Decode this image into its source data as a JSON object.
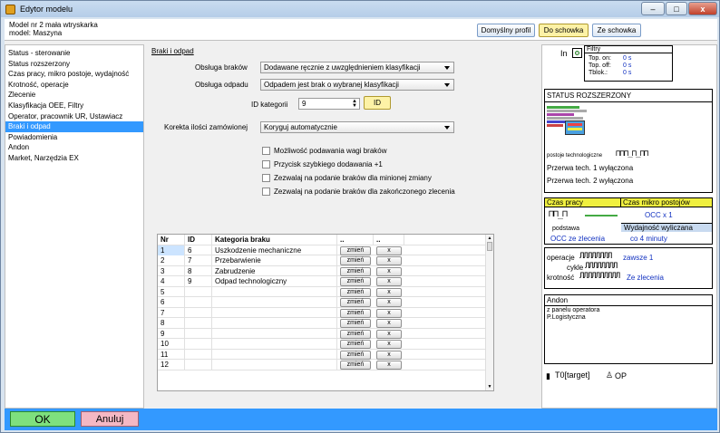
{
  "window": {
    "title": "Edytor modelu",
    "minimize": "–",
    "maximize": "□",
    "close": "x"
  },
  "header": {
    "line1": "Model nr 2  mała wtryskarka",
    "line2": "model: Maszyna",
    "btn_default_profile": "Domyślny profil",
    "btn_to_clipboard": "Do schowka",
    "btn_from_clipboard": "Ze schowka"
  },
  "sidebar": {
    "items": [
      {
        "label": "Status - sterowanie"
      },
      {
        "label": "Status rozszerzony"
      },
      {
        "label": "Czas pracy, mikro postoje, wydajność"
      },
      {
        "label": "Krotność, operacje"
      },
      {
        "label": "Zlecenie"
      },
      {
        "label": "Klasyfikacja OEE, Filtry"
      },
      {
        "label": "Operator, pracownik UR, Ustawiacz"
      },
      {
        "label": "Braki i odpad"
      },
      {
        "label": "Powiadomienia"
      },
      {
        "label": "Andon"
      },
      {
        "label": "Market, Narzędzia EX"
      }
    ],
    "selected_index": 7
  },
  "main": {
    "section_title": "Braki i odpad",
    "obsluga_brakow_label": "Obsługa braków",
    "obsluga_brakow_value": "Dodawane ręcznie z uwzględnieniem klasyfikacji",
    "obsluga_odpadu_label": "Obsługa odpadu",
    "obsluga_odpadu_value": "Odpadem jest brak o wybranej klasyfikacji",
    "id_kategorii_label": "ID kategorii",
    "id_kategorii_value": "9",
    "id_button": "ID",
    "korekta_label": "Korekta ilości zamówionej",
    "korekta_value": "Koryguj automatycznie",
    "checkboxes": [
      {
        "label": "Możliwość podawania wagi braków"
      },
      {
        "label": "Przycisk szybkiego dodawania +1"
      },
      {
        "label": "Zezwalaj na podanie braków dla minionej zmiany"
      },
      {
        "label": "Zezwalaj na podanie braków dla zakończonego zlecenia"
      }
    ]
  },
  "table": {
    "headers": {
      "nr": "Nr",
      "id": "ID",
      "cat": "Kategoria braku",
      "c1": "..",
      "c2": ".."
    },
    "edit_label": "zmień",
    "delete_label": "x",
    "rows": [
      {
        "nr": "1",
        "id": "6",
        "cat": "Uszkodzenie mechaniczne"
      },
      {
        "nr": "2",
        "id": "7",
        "cat": "Przebarwienie"
      },
      {
        "nr": "3",
        "id": "8",
        "cat": "Zabrudzenie"
      },
      {
        "nr": "4",
        "id": "9",
        "cat": "Odpad technologiczny"
      },
      {
        "nr": "5",
        "id": "",
        "cat": ""
      },
      {
        "nr": "6",
        "id": "",
        "cat": ""
      },
      {
        "nr": "7",
        "id": "",
        "cat": ""
      },
      {
        "nr": "8",
        "id": "",
        "cat": ""
      },
      {
        "nr": "9",
        "id": "",
        "cat": ""
      },
      {
        "nr": "10",
        "id": "",
        "cat": ""
      },
      {
        "nr": "11",
        "id": "",
        "cat": ""
      },
      {
        "nr": "12",
        "id": "",
        "cat": ""
      }
    ]
  },
  "right": {
    "in_label": "In",
    "filters_title": "Filtry",
    "top_on_label": "Top. on:",
    "top_on_value": "0 s",
    "top_off_label": "Top. off:",
    "top_off_value": "0 s",
    "tblok_label": "Tblok.:",
    "tblok_value": "0 s",
    "status_title": "STATUS ROZSZERZONY",
    "postoje_label": "postoje technologiczne",
    "przerwa1": "Przerwa tech. 1 wyłączona",
    "przerwa2": "Przerwa tech. 2 wyłączona",
    "czas_pracy": "Czas pracy",
    "czas_mikro": "Czas mikro postojów",
    "occ_x1": "OCC x 1",
    "podstawa": "podstawa",
    "wydajnosc": "Wydajność wyliczana",
    "occ_zlecenia": "OCC ze zlecenia",
    "co4": "co 4 minuty",
    "operacje_label": "operacje",
    "zawsze": "zawsze 1",
    "cykle_label": "cykle",
    "krotnosc_label": "krotność",
    "ze_zlecenia": "Ze zlecenia",
    "andon_title": "Andon",
    "andon_line1": "z panelu operatora",
    "andon_line2": "P.Logistyczna",
    "t0_target": "T0[target]",
    "op": "OP"
  },
  "footer": {
    "ok": "OK",
    "cancel": "Anuluj"
  },
  "colors": {
    "selection": "#3399ff",
    "ok_green": "#7ee07e",
    "cancel_pink": "#f4b8c4",
    "header_yellow": "#f0f040",
    "header_blue": "#c8daf0"
  }
}
